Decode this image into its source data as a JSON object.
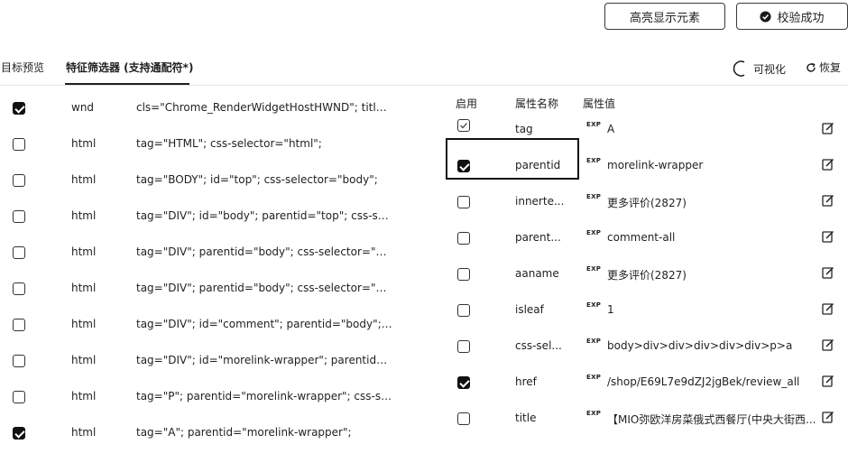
{
  "toolbar": {
    "highlight_label": "高亮显示元素",
    "verify_label": "校验成功"
  },
  "tabs": [
    {
      "label": "目标预览",
      "active": false
    },
    {
      "label": "特征筛选器 (支持通配符*)",
      "active": true
    }
  ],
  "tools": {
    "visualize_label": "可视化",
    "restore_label": "恢复"
  },
  "element_rows": [
    {
      "checked": true,
      "name": "wnd",
      "attrs": "cls=\"Chrome_RenderWidgetHostHWND\"; title=..."
    },
    {
      "checked": false,
      "name": "html",
      "attrs": "tag=\"HTML\"; css-selector=\"html\";"
    },
    {
      "checked": false,
      "name": "html",
      "attrs": "tag=\"BODY\"; id=\"top\"; css-selector=\"body\";"
    },
    {
      "checked": false,
      "name": "html",
      "attrs": "tag=\"DIV\"; id=\"body\"; parentid=\"top\"; css-sele..."
    },
    {
      "checked": false,
      "name": "html",
      "attrs": "tag=\"DIV\"; parentid=\"body\"; css-selector=\"bod..."
    },
    {
      "checked": false,
      "name": "html",
      "attrs": "tag=\"DIV\"; parentid=\"body\"; css-selector=\"bod..."
    },
    {
      "checked": false,
      "name": "html",
      "attrs": "tag=\"DIV\"; id=\"comment\"; parentid=\"body\"; cs..."
    },
    {
      "checked": false,
      "name": "html",
      "attrs": "tag=\"DIV\"; id=\"morelink-wrapper\"; parentid=\"c..."
    },
    {
      "checked": false,
      "name": "html",
      "attrs": "tag=\"P\"; parentid=\"morelink-wrapper\"; css-sele..."
    },
    {
      "checked": true,
      "name": "html",
      "attrs": "tag=\"A\"; parentid=\"morelink-wrapper\";"
    }
  ],
  "attr_table": {
    "headers": {
      "enabled": "启用",
      "name": "属性名称",
      "value": "属性值"
    },
    "exp_label": "EXP",
    "rows": [
      {
        "checked": true,
        "name": "tag",
        "value": "A"
      },
      {
        "checked": true,
        "name": "parentid",
        "value": "morelink-wrapper"
      },
      {
        "checked": false,
        "name": "innerte...",
        "value": "更多评价(2827)"
      },
      {
        "checked": false,
        "name": "parent...",
        "value": "comment-all"
      },
      {
        "checked": false,
        "name": "aaname",
        "value": "更多评价(2827)"
      },
      {
        "checked": false,
        "name": "isleaf",
        "value": "1"
      },
      {
        "checked": false,
        "name": "css-sel...",
        "value": "body>div>div>div>div>div>p>a"
      },
      {
        "checked": false,
        "name": "href",
        "value": "/shop/E69L7e9dZJ2jgBek/review_all"
      },
      {
        "checked": false,
        "name": "title",
        "value": "【MIO弥欧洋房菜俄式西餐厅(中央大街西..."
      }
    ]
  }
}
